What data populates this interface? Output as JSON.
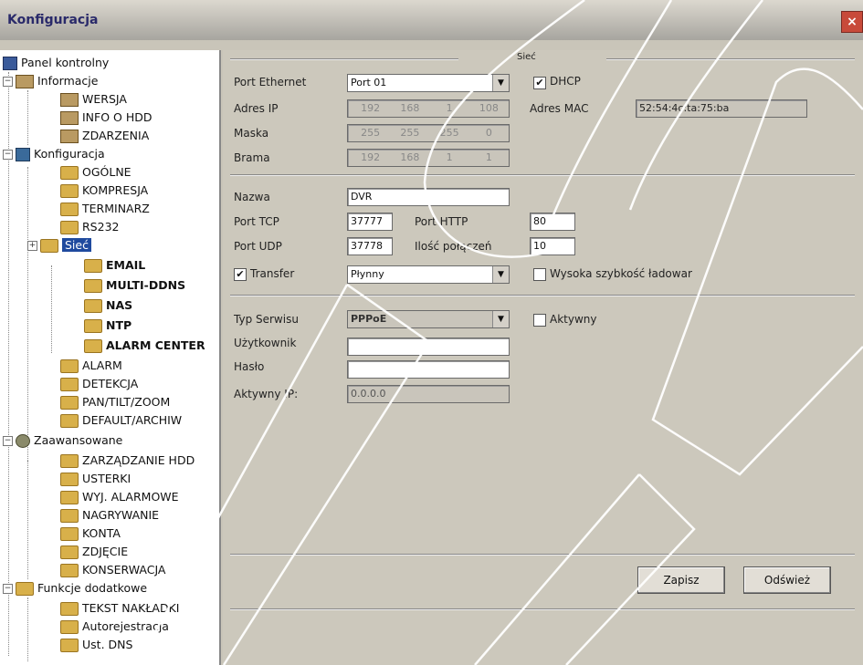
{
  "window": {
    "title": "Konfiguracja"
  },
  "tree": [
    {
      "label": "Panel kontrolny"
    },
    {
      "label": "Informacje"
    },
    {
      "label": "WERSJA"
    },
    {
      "label": "INFO O HDD"
    },
    {
      "label": "ZDARZENIA"
    },
    {
      "label": "Konfiguracja"
    },
    {
      "label": "OGÓLNE"
    },
    {
      "label": "KOMPRESJA"
    },
    {
      "label": "TERMINARZ"
    },
    {
      "label": "RS232"
    },
    {
      "label": "Sieć"
    },
    {
      "label": "EMAIL"
    },
    {
      "label": "MULTI-DDNS"
    },
    {
      "label": "NAS"
    },
    {
      "label": "NTP"
    },
    {
      "label": "ALARM CENTER"
    },
    {
      "label": "ALARM"
    },
    {
      "label": "DETEKCJA"
    },
    {
      "label": "PAN/TILT/ZOOM"
    },
    {
      "label": "DEFAULT/ARCHIW"
    },
    {
      "label": "Zaawansowane"
    },
    {
      "label": "ZARZĄDZANIE HDD"
    },
    {
      "label": "USTERKI"
    },
    {
      "label": "WYJ. ALARMOWE"
    },
    {
      "label": "NAGRYWANIE"
    },
    {
      "label": "KONTA"
    },
    {
      "label": "ZDJĘCIE"
    },
    {
      "label": "KONSERWACJA"
    },
    {
      "label": "Funkcje dodatkowe"
    },
    {
      "label": "TEKST NAKŁADKI"
    },
    {
      "label": "Autorejestracja"
    },
    {
      "label": "Ust. DNS"
    }
  ],
  "network": {
    "group_label": "Sieć",
    "port_ethernet_label": "Port Ethernet",
    "port_ethernet_value": "Port 01",
    "dhcp_label": "DHCP",
    "dhcp_checked": "✔",
    "ip_label": "Adres IP",
    "ip": [
      "192",
      "168",
      "1",
      "108"
    ],
    "mask_label": "Maska",
    "mask": [
      "255",
      "255",
      "255",
      "0"
    ],
    "gateway_label": "Brama",
    "gateway": [
      "192",
      "168",
      "1",
      "1"
    ],
    "mac_label": "Adres MAC",
    "mac_value": "52:54:4c:ta:75:ba",
    "name_label": "Nazwa",
    "name_value": "DVR",
    "tcp_label": "Port TCP",
    "tcp_value": "37777",
    "http_label": "Port HTTP",
    "http_value": "80",
    "udp_label": "Port UDP",
    "udp_value": "37778",
    "conn_label": "Ilość połączeń",
    "conn_value": "10",
    "transfer_label": "Transfer",
    "transfer_checked": "✔",
    "transfer_value": "Płynny",
    "fast_label": "Wysoka szybkość ładowar",
    "service_label": "Typ Serwisu",
    "service_value": "PPPoE",
    "active_label": "Aktywny",
    "user_label": "Użytkownik",
    "user_value": "",
    "password_label": "Hasło",
    "password_value": "",
    "active_ip_label": "Aktywny IP:",
    "active_ip_value": "0.0.0.0"
  },
  "buttons": {
    "save": "Zapisz",
    "cancel": "Odśwież"
  }
}
